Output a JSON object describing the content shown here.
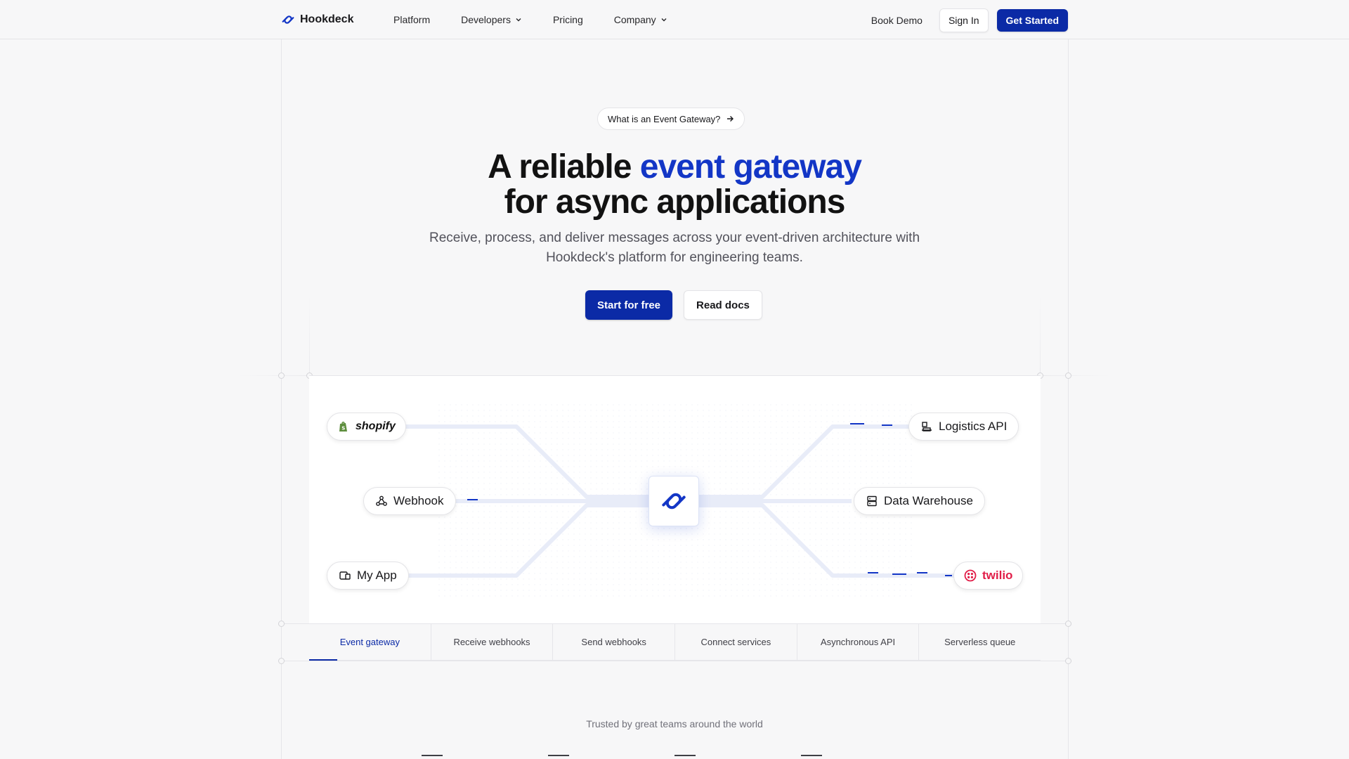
{
  "brand": {
    "name": "Hookdeck",
    "accent": "#1336c6",
    "primary": "#0b2aa6"
  },
  "nav": {
    "links": [
      {
        "label": "Platform",
        "has_dropdown": false
      },
      {
        "label": "Developers",
        "has_dropdown": true
      },
      {
        "label": "Pricing",
        "has_dropdown": false
      },
      {
        "label": "Company",
        "has_dropdown": true
      }
    ],
    "book_demo": "Book Demo",
    "sign_in": "Sign In",
    "get_started": "Get Started"
  },
  "hero": {
    "pill": "What is an Event Gateway?",
    "title_part1": "A reliable ",
    "title_accent": "event gateway",
    "title_line2": "for async applications",
    "subtitle_line1": "Receive, process, and deliver messages across your event-driven architecture with",
    "subtitle_line2": "Hookdeck's platform for engineering teams.",
    "cta_primary": "Start for free",
    "cta_secondary": "Read docs"
  },
  "diagram": {
    "sources": [
      {
        "label": "shopify",
        "icon": "shopify-icon"
      },
      {
        "label": "Webhook",
        "icon": "webhook-icon"
      },
      {
        "label": "My App",
        "icon": "app-icon"
      }
    ],
    "destinations": [
      {
        "label": "Logistics API",
        "icon": "logistics-icon"
      },
      {
        "label": "Data Warehouse",
        "icon": "database-icon"
      },
      {
        "label": "twilio",
        "icon": "twilio-icon"
      }
    ],
    "hub_icon": "hookdeck-logo-icon"
  },
  "tabs": [
    {
      "label": "Event gateway",
      "active": true
    },
    {
      "label": "Receive webhooks",
      "active": false
    },
    {
      "label": "Send webhooks",
      "active": false
    },
    {
      "label": "Connect services",
      "active": false
    },
    {
      "label": "Asynchronous API",
      "active": false
    },
    {
      "label": "Serverless queue",
      "active": false
    }
  ],
  "trusted": "Trusted by great teams around the world"
}
